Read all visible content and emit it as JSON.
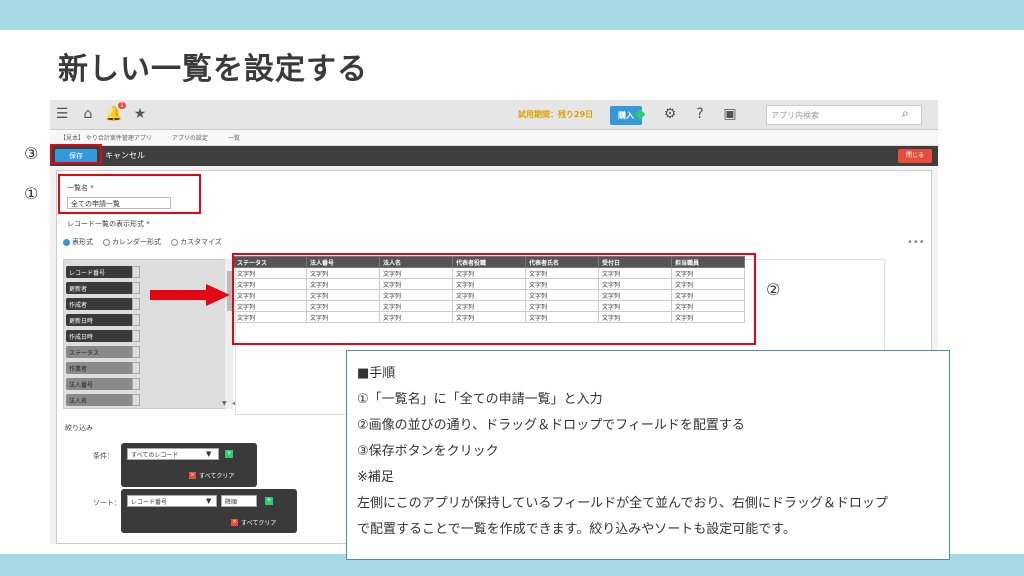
{
  "slide": {
    "title": "新しい一覧を設定する"
  },
  "header": {
    "trial_text": "試用期間：残り29日",
    "buy_label": "購入",
    "search_placeholder": "アプリ内検索",
    "bell_count": "1"
  },
  "breadcrumb": {
    "items": [
      "【見本】 やり合計案件管理アプリ",
      "アプリの設定",
      "一覧"
    ]
  },
  "actionbar": {
    "save_label": "保存",
    "cancel_label": "キャンセル",
    "close_label": "閉じる"
  },
  "form": {
    "list_name_label": "一覧名 *",
    "list_name_value": "全ての申請一覧",
    "display_format_label": "レコード一覧の表示形式 *",
    "formats": [
      "表形式",
      "カレンダー形式",
      "カスタマイズ"
    ]
  },
  "fields": [
    "レコード番号",
    "更新者",
    "作成者",
    "更新日時",
    "作成日時",
    "ステータス",
    "作業者",
    "法人番号",
    "法人名"
  ],
  "table": {
    "headers": [
      "ステータス",
      "法人番号",
      "法人名",
      "代表者役職",
      "代表者氏名",
      "受付日",
      "担当職員"
    ],
    "cell": "文字列",
    "rows": 5
  },
  "filter": {
    "section_label": "絞り込み",
    "condition_label": "条件：",
    "condition_value": "すべてのレコード",
    "clear_label": "すべてクリア",
    "sort_label": "ソート：",
    "sort_value": "レコード番号",
    "sort_order": "降順"
  },
  "markers": {
    "m1": "①",
    "m2": "②",
    "m3": "③"
  },
  "note": {
    "lines": [
      "■手順",
      "①「一覧名」に「全ての申請一覧」と入力",
      "②画像の並びの通り、ドラッグ＆ドロップでフィールドを配置する",
      "③保存ボタンをクリック",
      "※補足",
      "左側にこのアプリが保持しているフィールドが全て並んでおり、右側にドラッグ＆ドロップ",
      "で配置することで一覧を作成できます。絞り込みやソートも設定可能です。"
    ]
  },
  "colors": {
    "band": "#a6d8e6",
    "accent": "#3498db",
    "highlight": "#e30613"
  }
}
